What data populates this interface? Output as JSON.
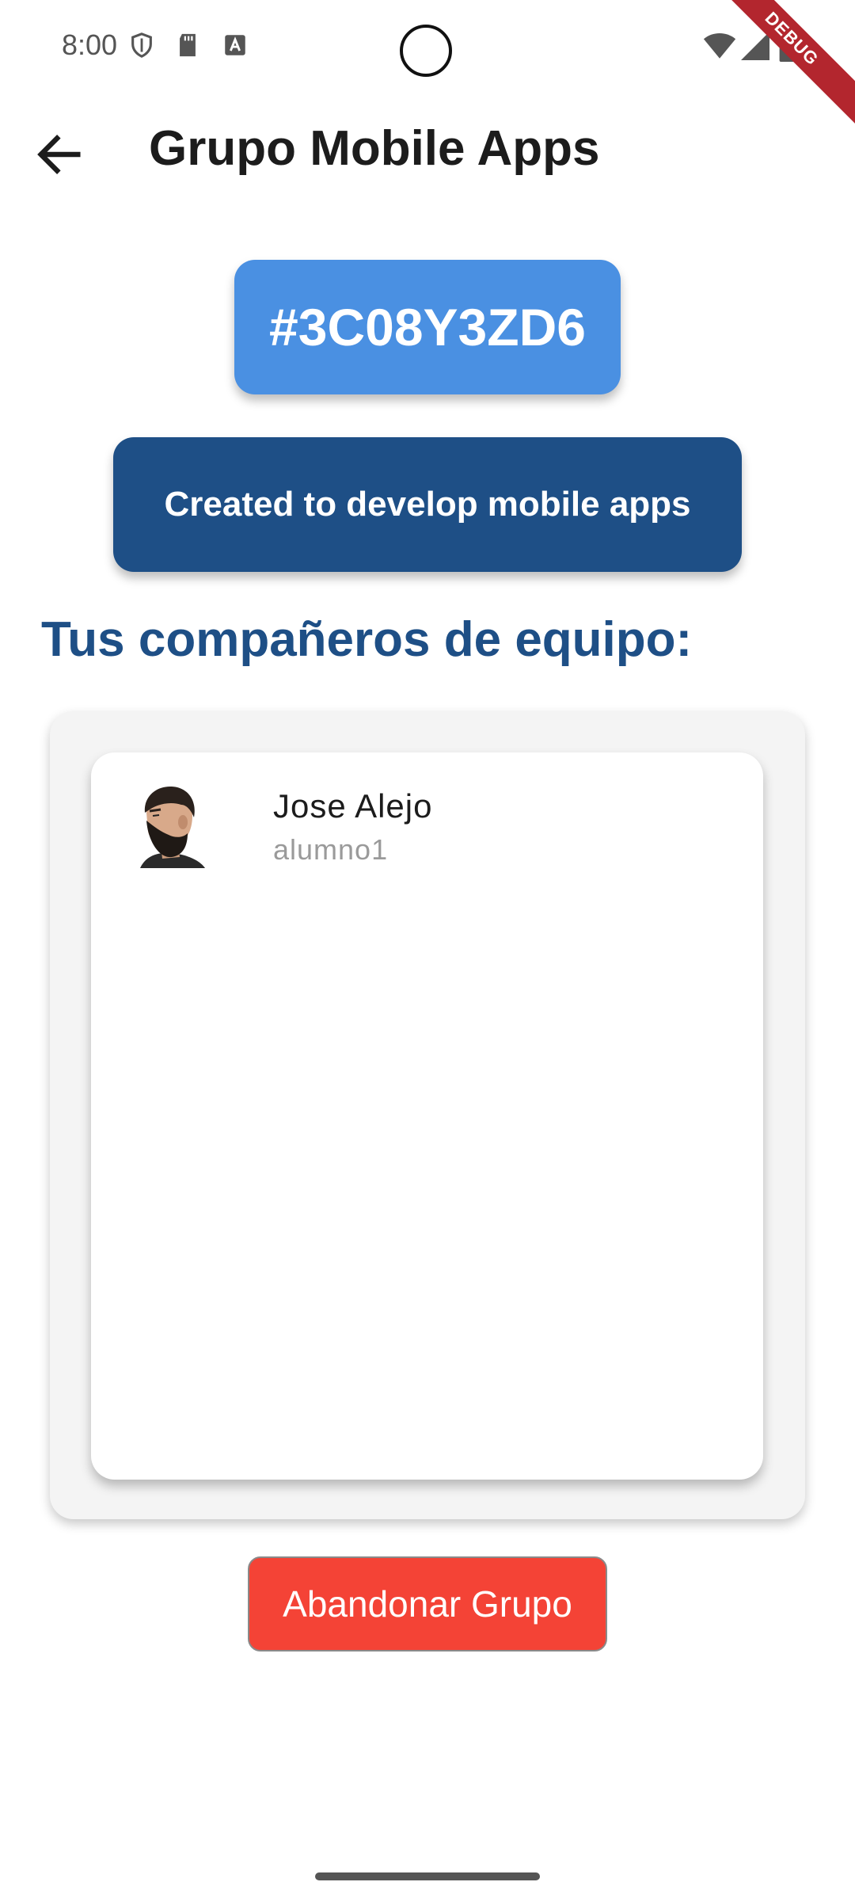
{
  "status_bar": {
    "time": "8:00",
    "left_icons": [
      "shield-icon",
      "sd-card-icon",
      "text-a-icon"
    ],
    "right_icons": [
      "wifi-icon",
      "signal-icon",
      "battery-icon"
    ],
    "debug_label": "DEBUG"
  },
  "app_bar": {
    "back_icon": "arrow-left-icon",
    "title": "Grupo Mobile Apps"
  },
  "group": {
    "code": "#3C08Y3ZD6",
    "description": "Created to develop mobile apps"
  },
  "members_section": {
    "heading": "Tus compañeros de equipo:",
    "members": [
      {
        "name": "Jose Alejo",
        "username": "alumno1",
        "avatar_icon": "bearded-man-avatar"
      }
    ]
  },
  "actions": {
    "leave_label": "Abandonar Grupo"
  },
  "colors": {
    "code_badge": "#4a90e2",
    "description_bg": "#1e4f86",
    "heading": "#1e4f86",
    "leave_button": "#f44336",
    "debug_ribbon": "#b3262e"
  }
}
